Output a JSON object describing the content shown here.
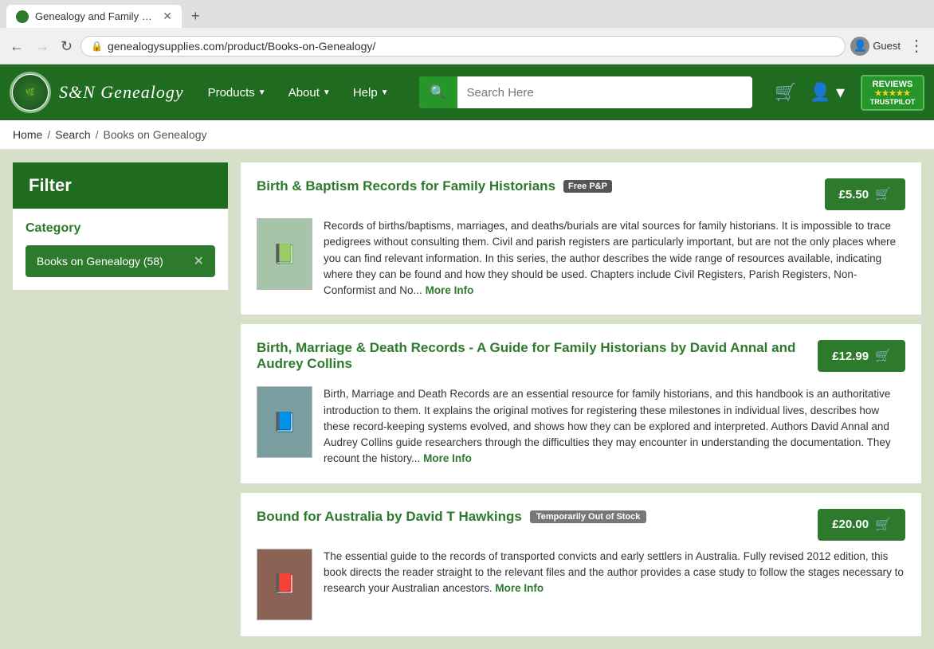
{
  "browser": {
    "tab_title": "Genealogy and Family History P...",
    "url": "genealogysupplies.com/product/Books-on-Genealogy/",
    "new_tab_label": "+",
    "guest_label": "Guest"
  },
  "header": {
    "site_name_prefix": "S&N",
    "site_name_suffix": "Genealogy",
    "nav_items": [
      {
        "label": "Products",
        "has_dropdown": true
      },
      {
        "label": "About",
        "has_dropdown": true
      },
      {
        "label": "Help",
        "has_dropdown": true
      }
    ],
    "search_placeholder": "Search Here",
    "reviews_label": "REVIEWS",
    "reviews_sub": "TRUSTPILOT"
  },
  "breadcrumb": {
    "home": "Home",
    "search": "Search",
    "current": "Books on Genealogy"
  },
  "sidebar": {
    "filter_label": "Filter",
    "category_label": "Category",
    "category_tag": "Books on Genealogy (58)"
  },
  "products": [
    {
      "title": "Birth & Baptism Records for Family Historians",
      "badge": "Free P&P",
      "badge_type": "free",
      "price": "£5.50",
      "description": "Records of births/baptisms, marriages, and deaths/burials are vital sources for family historians. It is impossible to trace pedigrees without consulting them. Civil and parish registers are particularly important, but are not the only places where you can find relevant information. In this series, the author describes the wide range of resources available, indicating where they can be found and how they should be used. Chapters include Civil Registers, Parish Registers, Non-Conformist and No...",
      "more_info_label": "More Info",
      "img_color": "#a8c4a8"
    },
    {
      "title": "Birth, Marriage & Death Records - A Guide for Family Historians by David Annal and Audrey Collins",
      "badge": null,
      "badge_type": null,
      "price": "£12.99",
      "description": "Birth, Marriage and Death Records are an essential resource for family historians, and this handbook is an authoritative introduction to them. It explains the original motives for registering these milestones in individual lives, describes how these record-keeping systems evolved, and shows how they can be explored and interpreted. Authors David Annal and Audrey Collins guide researchers through the difficulties they may encounter in understanding the documentation. They recount the history...",
      "more_info_label": "More Info",
      "img_color": "#7a9e9f"
    },
    {
      "title": "Bound for Australia by David T Hawkings",
      "badge": "Temporarily Out of Stock",
      "badge_type": "stock",
      "price": "£20.00",
      "description": "The essential guide to the records of transported convicts and early settlers in Australia. Fully revised 2012 edition, this book directs the reader straight to the relevant files and the author provides a case study to follow the stages necessary to research your Australian ancestors.",
      "more_info_label": "More Info",
      "img_color": "#8b6355"
    }
  ],
  "buttons": {
    "add_to_cart": "🛒"
  }
}
